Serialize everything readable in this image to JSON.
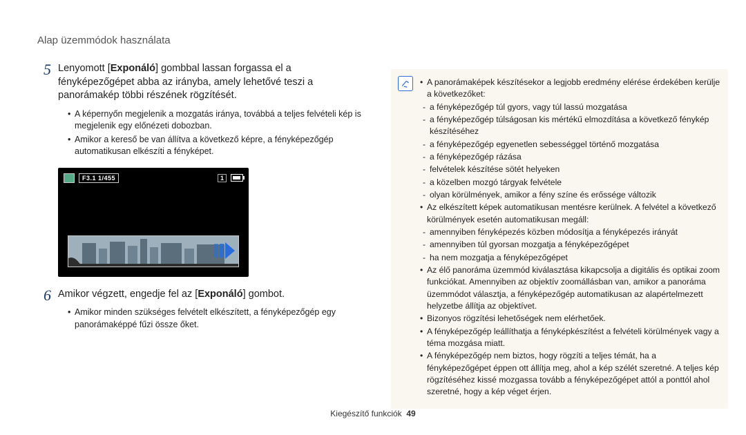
{
  "header": {
    "title": "Alap üzemmódok használata"
  },
  "step5": {
    "num": "5",
    "pre": "Lenyomott [",
    "bold": "Exponáló",
    "post": "] gombbal lassan forgassa el a fényképezőgépet abba az irányba, amely lehetővé teszi a panorámakép többi részének rögzítését.",
    "b1": "A képernyőn megjelenik a mozgatás iránya, továbbá a teljes felvételi kép is megjelenik egy előnézeti dobozban.",
    "b2": "Amikor a kereső be van állítva a következő képre, a fényképezőgép automatikusan elkészíti a fényképet."
  },
  "camera": {
    "exposure": "F3.1 1/455",
    "count": "1"
  },
  "step6": {
    "num": "6",
    "pre": "Amikor végzett, engedje fel az [",
    "bold": "Exponáló",
    "post": "] gombot.",
    "b1": "Amikor minden szükséges felvételt elkészített, a fényképezőgép egy panorámaképpé fűzi össze őket."
  },
  "note": {
    "top": "A panorámaképek készítésekor a legjobb eredmény elérése érdekében kerülje a következőket:",
    "d1": "a fényképezőgép túl gyors, vagy túl lassú mozgatása",
    "d2": "a fényképezőgép túlságosan kis mértékű elmozdítása a következő fénykép készítéséhez",
    "d3": "a fényképezőgép egyenetlen sebességgel történő mozgatása",
    "d4": "a fényképezőgép rázása",
    "d5": "felvételek készítése sötét helyeken",
    "d6": "a közelben mozgó tárgyak felvétele",
    "d7": "olyan körülmények, amikor a fény színe és erőssége változik",
    "top2": "Az elkészített képek automatikusan mentésre kerülnek. A felvétel a következő körülmények esetén automatikusan megáll:",
    "e1": "amennyiben fényképezés közben módosítja a fényképezés irányát",
    "e2": "amennyiben túl gyorsan mozgatja a fényképezőgépet",
    "e3": "ha nem mozgatja a fényképezőgépet",
    "f1": "Az élő panoráma üzemmód kiválasztása kikapcsolja a digitális és optikai zoom funkciókat. Amennyiben az objektív zoomállásban van, amikor a panoráma üzemmódot választja, a fényképezőgép automatikusan az alapértelmezett helyzetbe állítja az objektívet.",
    "f2": "Bizonyos rögzítési lehetőségek nem elérhetőek.",
    "f3": "A fényképezőgép leállíthatja a fényképkészítést a felvételi körülmények vagy a téma mozgása miatt.",
    "f4": "A fényképezőgép nem biztos, hogy rögzíti a teljes témát, ha a fényképezőgépet éppen ott állítja meg, ahol a kép szélét szeretné. A teljes kép rögzítéséhez kissé mozgassa tovább a fényképezőgépet attól a ponttól ahol szeretné, hogy a kép véget érjen."
  },
  "footer": {
    "section": "Kiegészítő funkciók",
    "page": "49"
  }
}
